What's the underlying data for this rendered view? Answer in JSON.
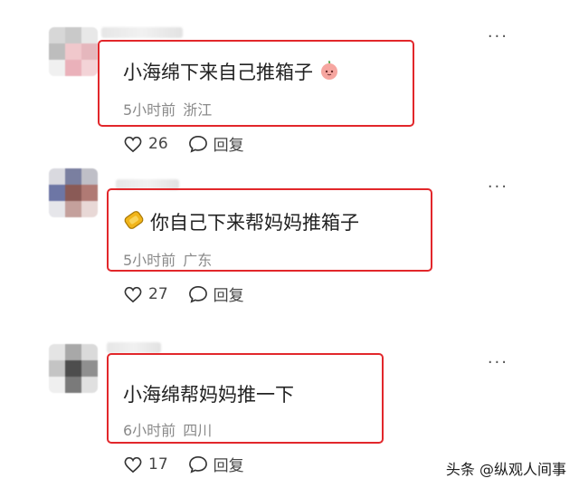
{
  "comments": [
    {
      "text": "小海绵下来自己推箱子",
      "emoji": "peach-emoji",
      "time": "5小时前",
      "location": "浙江",
      "likes": "26",
      "reply_label": "回复"
    },
    {
      "text": "你自己下来帮妈妈推箱子",
      "emoji": "gold-bar-emoji",
      "time": "5小时前",
      "location": "广东",
      "likes": "27",
      "reply_label": "回复"
    },
    {
      "text": "小海绵帮妈妈推一下",
      "time": "6小时前",
      "location": "四川",
      "likes": "17",
      "reply_label": "回复"
    }
  ],
  "more_label": "···",
  "watermark": "头条 @纵观人间事",
  "colors": {
    "highlight_box": "#e2272b",
    "meta_text": "#8a8a8a"
  }
}
